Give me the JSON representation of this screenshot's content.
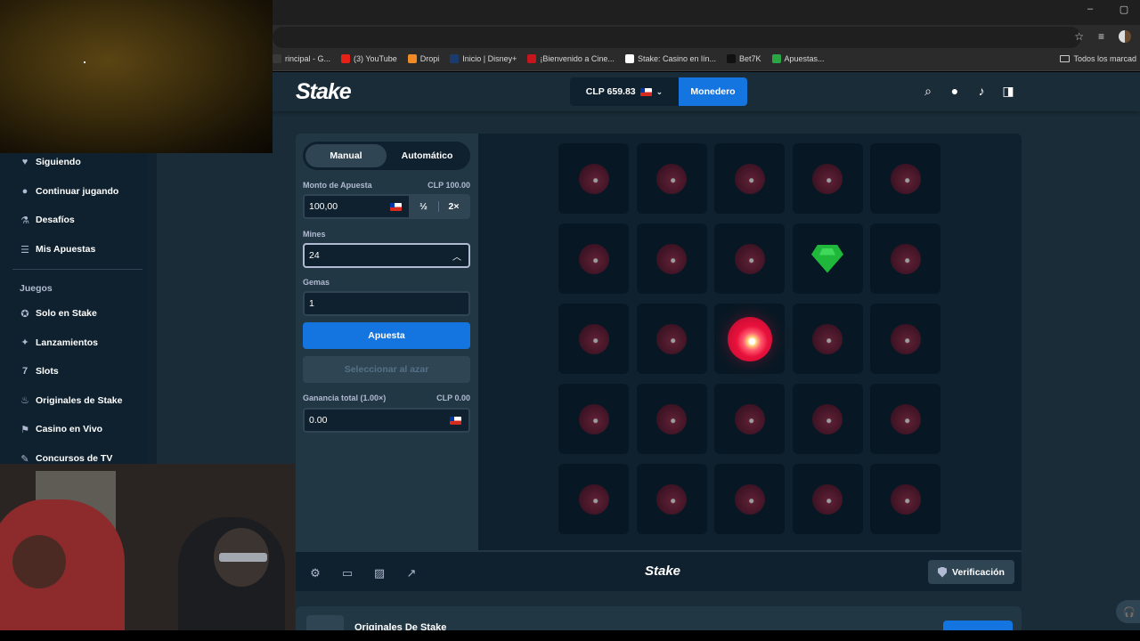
{
  "browser": {
    "window_controls": [
      "–",
      "▢"
    ],
    "bookmarks": [
      {
        "label": "rincipal - G...",
        "color": "#3a3a3a"
      },
      {
        "label": "(3) YouTube",
        "color": "#e62117"
      },
      {
        "label": "Dropi",
        "color": "#f08a24"
      },
      {
        "label": "Inicio | Disney+",
        "color": "#1b3b6f"
      },
      {
        "label": "¡Bienvenido a Cine...",
        "color": "#c4161c"
      },
      {
        "label": "Stake: Casino en lín...",
        "color": "#ffffff"
      },
      {
        "label": "Bet7K",
        "color": "#111111"
      },
      {
        "label": "Apuestas...",
        "color": "#29a745"
      }
    ],
    "bookmarks_folder": "Todos los marcad"
  },
  "header": {
    "logo": "Stake",
    "balance": "CLP 659.83",
    "wallet_button": "Monedero"
  },
  "sidebar": {
    "items_top": [
      {
        "label": "Siguiendo",
        "icon": "heart-icon",
        "glyph": "♥"
      },
      {
        "label": "Continuar jugando",
        "icon": "play-icon",
        "glyph": "●"
      },
      {
        "label": "Desafíos",
        "icon": "flask-icon",
        "glyph": "⚗"
      },
      {
        "label": "Mis Apuestas",
        "icon": "list-icon",
        "glyph": "☰"
      }
    ],
    "section_title": "Juegos",
    "items_games": [
      {
        "label": "Solo en Stake",
        "icon": "star-badge-icon",
        "glyph": "✪"
      },
      {
        "label": "Lanzamientos",
        "icon": "sparkle-icon",
        "glyph": "✦"
      },
      {
        "label": "Slots",
        "icon": "slots-icon",
        "glyph": "7"
      },
      {
        "label": "Originales de Stake",
        "icon": "fire-icon",
        "glyph": "♨"
      },
      {
        "label": "Casino en Vivo",
        "icon": "live-icon",
        "glyph": "⚑"
      },
      {
        "label": "Concursos de TV",
        "icon": "mic-icon",
        "glyph": "✎"
      }
    ]
  },
  "controls": {
    "mode_manual": "Manual",
    "mode_auto": "Automático",
    "bet_amount_label": "Monto de Apuesta",
    "bet_amount_clp": "CLP 100.00",
    "bet_amount_value": "100,00",
    "half": "½",
    "double": "2×",
    "mines_label": "Mines",
    "mines_value": "24",
    "gems_label": "Gemas",
    "gems_value": "1",
    "bet_button": "Apuesta",
    "random_button": "Seleccionar al azar",
    "profit_label": "Ganancia total (1.00×)",
    "profit_clp": "CLP 0.00",
    "profit_value": "0.00"
  },
  "board": {
    "cells": [
      "mine",
      "mine",
      "mine",
      "mine",
      "mine",
      "mine",
      "mine",
      "mine",
      "gem",
      "mine",
      "mine",
      "mine",
      "hit",
      "mine",
      "mine",
      "mine",
      "mine",
      "mine",
      "mine",
      "mine",
      "mine",
      "mine",
      "mine",
      "mine",
      "mine"
    ]
  },
  "footer": {
    "logo": "Stake",
    "verify_button": "Verificación"
  },
  "originals": {
    "title": "Originales De Stake"
  },
  "colors": {
    "accent": "#1475e1",
    "panel": "#213743",
    "background": "#1a2c38",
    "mine": "#e9113c",
    "gem": "#1fb83a"
  }
}
